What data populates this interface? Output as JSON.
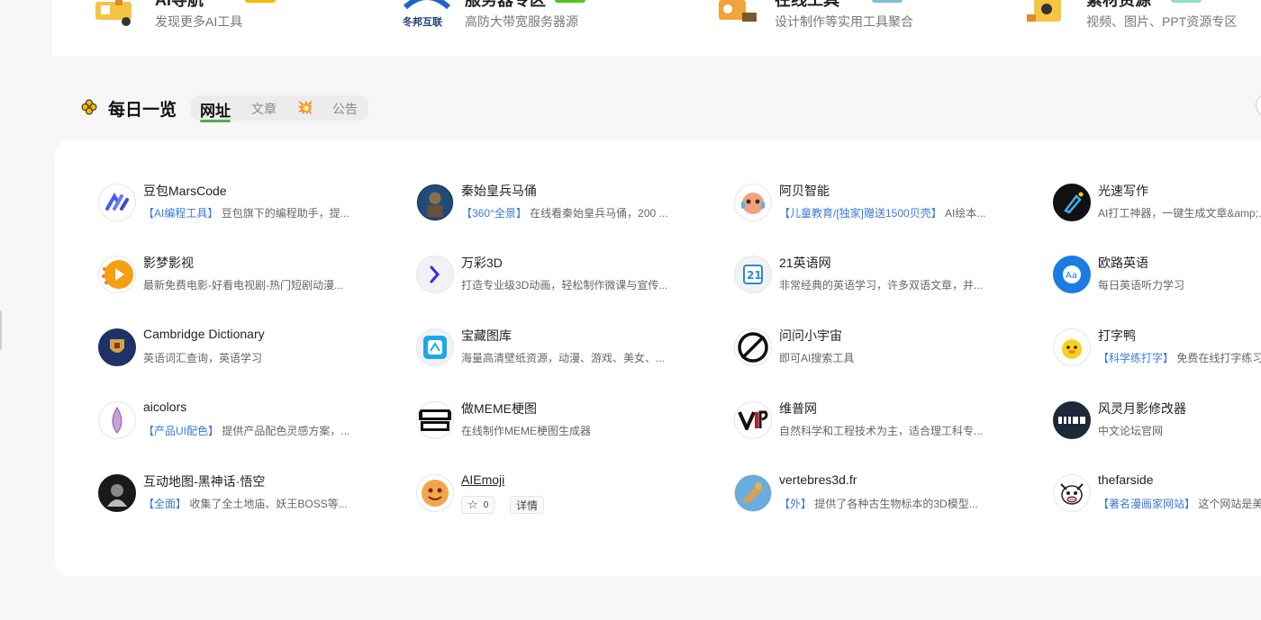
{
  "top_banner": [
    {
      "title": "AI导航",
      "subtitle": "发现更多AI工具",
      "tag_color": "#f5b800"
    },
    {
      "title": "服务器专区",
      "subtitle": "高防大带宽服务器源",
      "tag_color": "#52c41a",
      "logo_text": "冬邦互联"
    },
    {
      "title": "在线工具",
      "subtitle": "设计制作等实用工具聚合",
      "tag_color": "#7fbfd6"
    },
    {
      "title": "素材资源",
      "subtitle": "视频、图片、PPT资源专区",
      "tag_color": "#8fe0c0"
    }
  ],
  "section": {
    "title": "每日一览",
    "tabs": [
      "网址",
      "文章",
      "💥",
      "公告"
    ],
    "active_tab": "网址"
  },
  "sites": [
    {
      "name": "豆包MarsCode",
      "tag": "【AI编程工具】",
      "desc": "豆包旗下的编程助手，提...",
      "logo": "marscode-logo"
    },
    {
      "name": "秦始皇兵马俑",
      "tag": "【360°全景】",
      "desc": "在线看秦始皇兵马俑，200 ...",
      "logo": "terracotta-logo"
    },
    {
      "name": "阿贝智能",
      "tag": "【儿童教育/[独家]赠送1500贝壳】",
      "desc": "AI绘本...",
      "logo": "abei-logo"
    },
    {
      "name": "光速写作",
      "tag": "",
      "desc": "AI打工神器，一键生成文章&amp;...",
      "logo": "guangsu-logo"
    },
    {
      "name": "影梦影视",
      "tag": "",
      "desc": "最新免费电影-好看电视剧-热门短剧动漫...",
      "logo": "yingmeng-logo"
    },
    {
      "name": "万彩3D",
      "tag": "",
      "desc": "打造专业级3D动画，轻松制作微课与宣传...",
      "logo": "wancai-logo"
    },
    {
      "name": "21英语网",
      "tag": "",
      "desc": "非常经典的英语学习，许多双语文章，并...",
      "logo": "21en-logo"
    },
    {
      "name": "欧路英语",
      "tag": "",
      "desc": "每日英语听力学习",
      "logo": "eudic-logo"
    },
    {
      "name": "Cambridge Dictionary",
      "tag": "",
      "desc": "英语词汇查询，英语学习",
      "logo": "cambridge-logo"
    },
    {
      "name": "宝藏图库",
      "tag": "",
      "desc": "海量高清壁纸资源，动漫、游戏、美女、...",
      "logo": "baozang-logo"
    },
    {
      "name": "问问小宇宙",
      "tag": "",
      "desc": "即可AI搜索工具",
      "logo": "wenwen-logo"
    },
    {
      "name": "打字鸭",
      "tag": "【科学练打字】",
      "desc": "免费在线打字练习",
      "logo": "duck-logo"
    },
    {
      "name": "aicolors",
      "tag": "【产品UI配色】",
      "desc": "提供产品配色灵感方案，...",
      "logo": "aicolors-logo"
    },
    {
      "name": "做MEME梗图",
      "tag": "",
      "desc": "在线制作MEME梗图生成器",
      "logo": "zuomeme-logo"
    },
    {
      "name": "维普网",
      "tag": "",
      "desc": "自然科学和工程技术为主，适合理工科专...",
      "logo": "vip-logo"
    },
    {
      "name": "风灵月影修改器",
      "tag": "",
      "desc": "中文论坛官网",
      "logo": "fling-logo"
    },
    {
      "name": "互动地图-黑神话·悟空",
      "tag": "【全面】",
      "desc": "收集了全土地庙、妖王BOSS等...",
      "logo": "wukong-logo"
    },
    {
      "name": "AIEmoji",
      "tag": "",
      "desc": "",
      "logo": "aiemoji-logo",
      "likes": "0",
      "detail": "详情"
    },
    {
      "name": "vertebres3d.fr",
      "tag": "【外】",
      "desc": "提供了各种古生物标本的3D模型...",
      "logo": "vertebres-logo"
    },
    {
      "name": "thefarside",
      "tag": "【著名漫画家网站】",
      "desc": "这个网站是美",
      "logo": "farside-logo"
    }
  ]
}
